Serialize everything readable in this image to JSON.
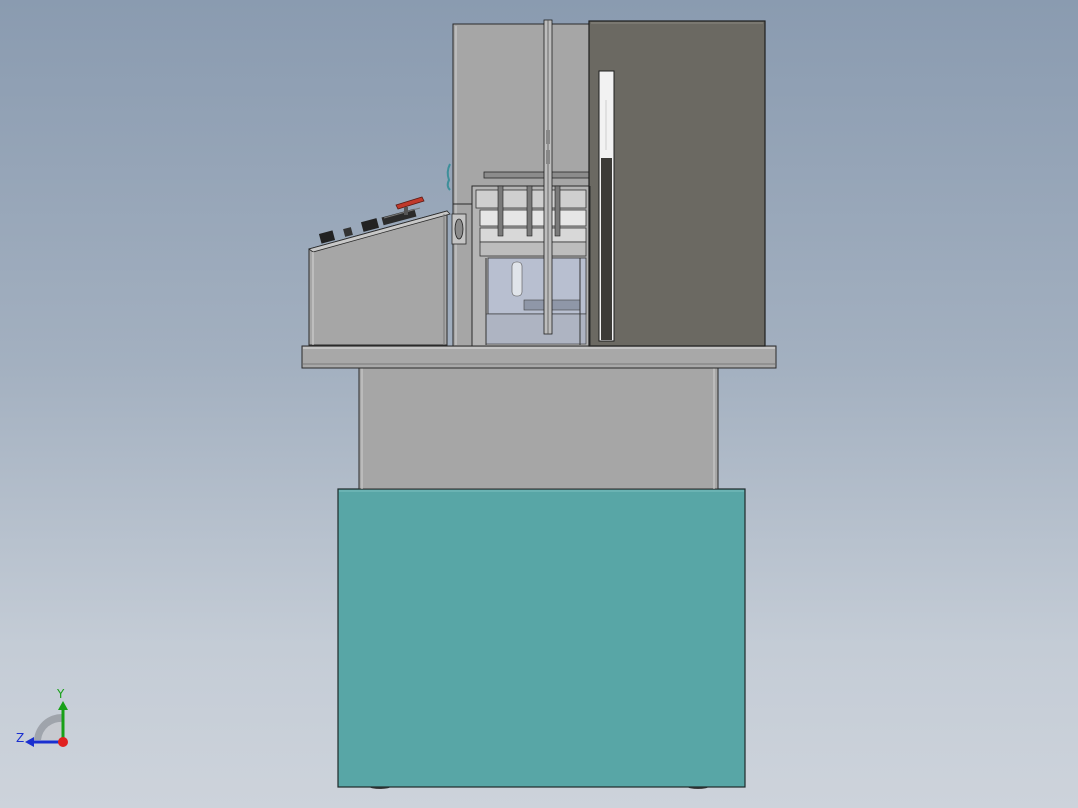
{
  "viewport": {
    "background_top": "#8a9bb0",
    "background_bottom": "#cdd3db"
  },
  "model": {
    "description_colors": {
      "cabinet": "#58a6a6",
      "panel_gray": "#a6a6a6",
      "dark_cover": "#6b6962",
      "handle_red": "#c0392b"
    }
  },
  "triad": {
    "y_label": "Y",
    "z_label": "Z",
    "y_color": "#18a018",
    "z_color": "#1a2fd0",
    "x_color": "#e02020"
  }
}
